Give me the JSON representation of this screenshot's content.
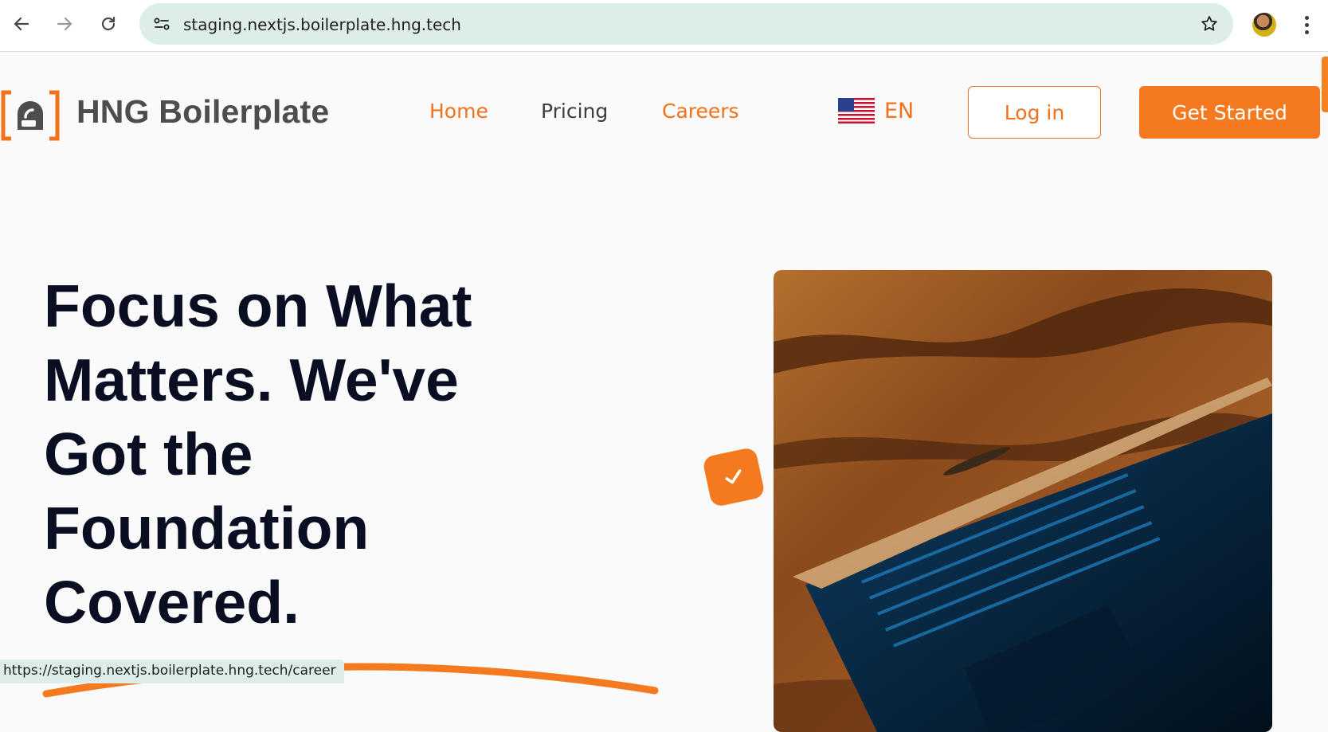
{
  "browser": {
    "url": "staging.nextjs.boilerplate.hng.tech",
    "status_url": "https://staging.nextjs.boilerplate.hng.tech/career",
    "icons": [
      "back-arrow-icon",
      "forward-arrow-icon",
      "reload-icon",
      "site-info-icon",
      "star-icon",
      "profile-avatar",
      "more-menu-icon"
    ]
  },
  "header": {
    "brand": "HNG Boilerplate",
    "nav": [
      {
        "label": "Home",
        "active": true
      },
      {
        "label": "Pricing",
        "active": false
      },
      {
        "label": "Careers",
        "active": false
      }
    ],
    "language": "EN",
    "login_label": "Log in",
    "get_started_label": "Get Started"
  },
  "hero": {
    "title": "Focus on What Matters. We've Got the Foundation Covered.",
    "image_subject": "open laptop with blue backlit keyboard on wooden desk"
  },
  "colors": {
    "accent": "#f57a1f",
    "heading": "#0a0e22",
    "brand_text": "#4d4d4d",
    "background": "#fafafa"
  }
}
